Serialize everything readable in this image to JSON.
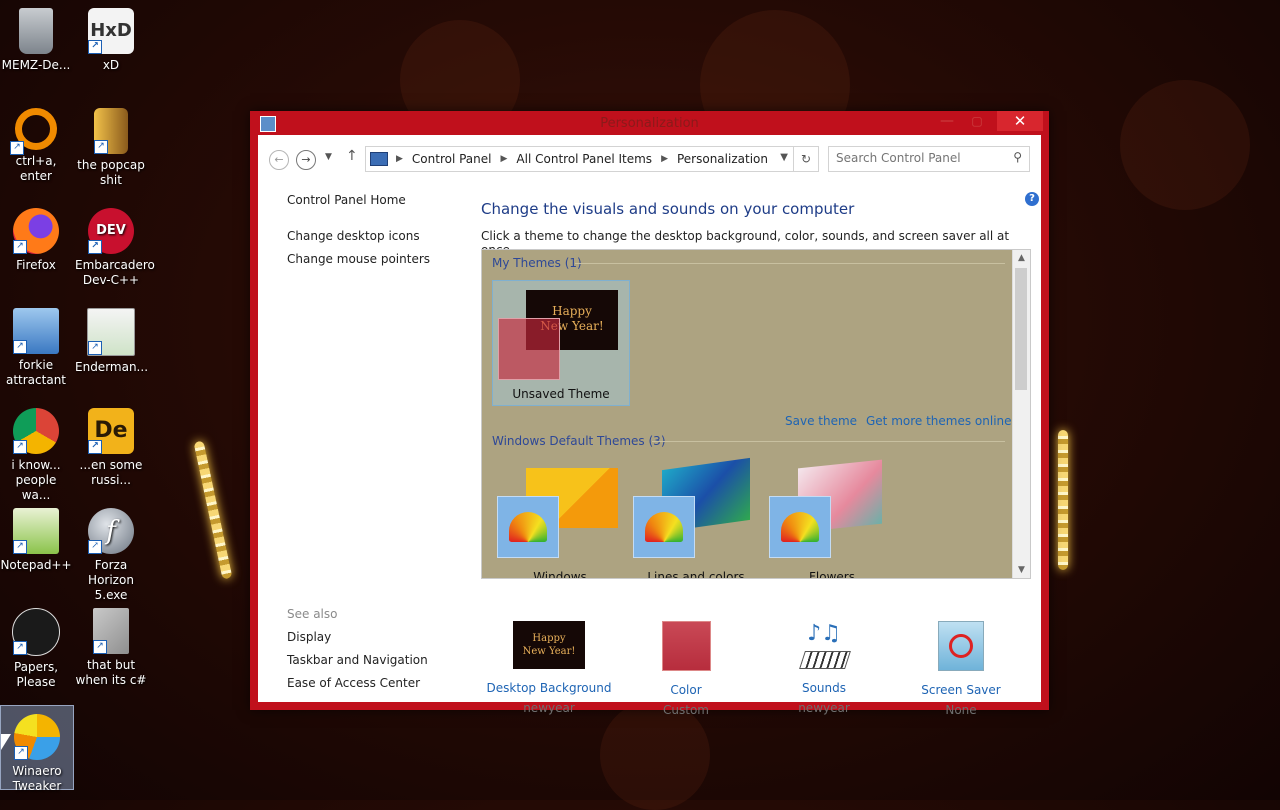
{
  "desktop": {
    "icons": [
      {
        "label": "MEMZ-De...",
        "icon": "recycle-bin-icon"
      },
      {
        "label": "xD",
        "icon": "hxd-icon"
      },
      {
        "label": "ctrl+a, enter",
        "icon": "ring-icon"
      },
      {
        "label": "the popcap shit",
        "icon": "book-icon"
      },
      {
        "label": "Firefox",
        "icon": "firefox-icon"
      },
      {
        "label": "Embarcadero Dev-C++",
        "icon": "devcpp-icon"
      },
      {
        "label": "forkie attractant",
        "icon": "network-icon"
      },
      {
        "label": "Enderman...",
        "icon": "window-app-icon"
      },
      {
        "label": "i know... people wa...",
        "icon": "chrome-icon"
      },
      {
        "label": "...en some russi...",
        "icon": "de-icon"
      },
      {
        "label": "Notepad++",
        "icon": "notepadpp-icon"
      },
      {
        "label": "Forza Horizon 5.exe",
        "icon": "flash-icon"
      },
      {
        "label": "Papers, Please",
        "icon": "papers-please-icon"
      },
      {
        "label": "that but when its c#",
        "icon": "stacked-windows-icon"
      },
      {
        "label": "Winaero Tweaker",
        "icon": "winaero-icon"
      }
    ]
  },
  "window": {
    "title": "Personalization",
    "close_glyph": "✕",
    "minimize_glyph": "—",
    "maximize_glyph": "▢"
  },
  "address": {
    "crumbs": [
      "Control Panel",
      "All Control Panel Items",
      "Personalization"
    ],
    "search_placeholder": "Search Control Panel"
  },
  "left_pane": {
    "home": "Control Panel Home",
    "links": [
      "Change desktop icons",
      "Change mouse pointers"
    ],
    "see_also_title": "See also",
    "see_also": [
      "Display",
      "Taskbar and Navigation",
      "Ease of Access Center"
    ]
  },
  "main": {
    "heading": "Change the visuals and sounds on your computer",
    "description": "Click a theme to change the desktop background, color, sounds, and screen saver all at once.",
    "my_themes_title": "My Themes (1)",
    "unsaved_theme": "Unsaved Theme",
    "ny_line1": "Happy",
    "ny_line2": "New Year!",
    "save_theme": "Save theme",
    "get_more": "Get more themes online",
    "default_title": "Windows Default Themes (3)",
    "default_themes": [
      "Windows",
      "Lines and colors",
      "Flowers"
    ]
  },
  "customizations": [
    {
      "label": "Desktop Background",
      "value": "newyear"
    },
    {
      "label": "Color",
      "value": "Custom"
    },
    {
      "label": "Sounds",
      "value": "newyear"
    },
    {
      "label": "Screen Saver",
      "value": "None"
    }
  ],
  "colors": {
    "window_frame": "#c0101c",
    "theme_background": "#ada381",
    "link_blue": "#1e64b4"
  }
}
